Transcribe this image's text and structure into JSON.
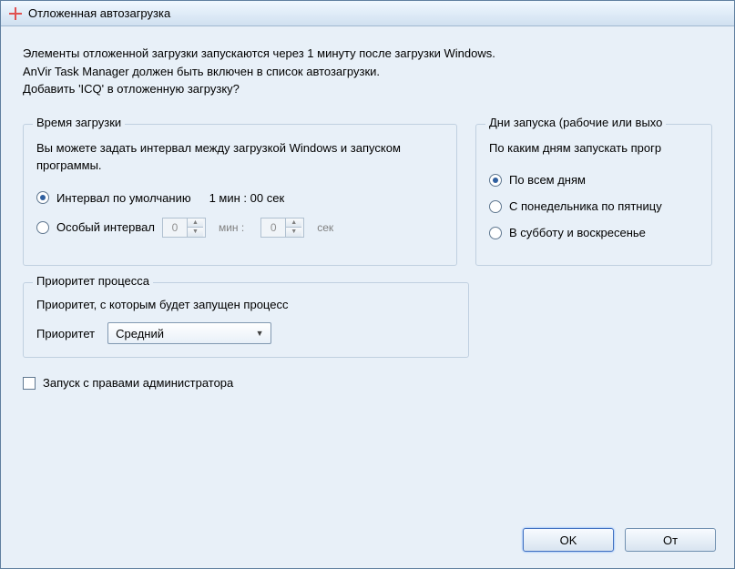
{
  "titlebar": {
    "icon": "plus-icon",
    "title": "Отложенная автозагрузка"
  },
  "description": {
    "line1": "Элементы отложенной загрузки запускаются через 1 минуту после загрузки Windows.",
    "line2": "AnVir Task Manager должен быть включен в список автозагрузки.",
    "line3": "Добавить 'ICQ' в отложенную загрузку?"
  },
  "loadtime": {
    "title": "Время загрузки",
    "helper": "Вы можете задать интервал между загрузкой Windows и запуском программы.",
    "radio_default": "Интервал по умолчанию",
    "default_value": "1 мин : 00 сек",
    "radio_custom": "Особый интервал",
    "custom_min": "0",
    "custom_sec": "0",
    "unit_min": "мин :",
    "unit_sec": "сек"
  },
  "days": {
    "title": "Дни запуска (рабочие или выхо",
    "helper": "По каким дням запускать прогр",
    "radio_all": "По всем дням",
    "radio_weekdays": "С понедельника по пятницу",
    "radio_weekend": "В субботу и воскресенье"
  },
  "priority": {
    "title": "Приоритет процесса",
    "helper": "Приоритет, с которым будет запущен процесс",
    "label": "Приоритет",
    "selected": "Средний"
  },
  "admin_checkbox": "Запуск с правами администратора",
  "buttons": {
    "ok": "OK",
    "cancel": "От"
  }
}
